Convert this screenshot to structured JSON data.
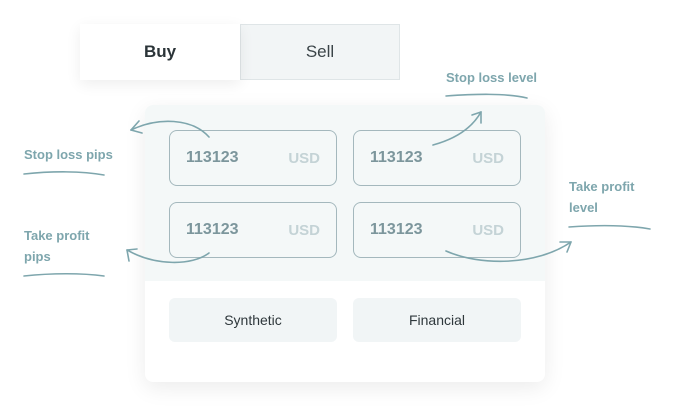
{
  "tabs": {
    "buy": "Buy",
    "sell": "Sell"
  },
  "fields": [
    {
      "value": "113123",
      "currency": "USD"
    },
    {
      "value": "113123",
      "currency": "USD"
    },
    {
      "value": "113123",
      "currency": "USD"
    },
    {
      "value": "113123",
      "currency": "USD"
    }
  ],
  "options": {
    "synthetic": "Synthetic",
    "financial": "Financial"
  },
  "annotations": {
    "stop_loss_level": "Stop loss level",
    "stop_loss_pips": "Stop loss pips",
    "take_profit_pips": "Take profit pips",
    "take_profit_level": "Take profit level"
  },
  "colors": {
    "annotation": "#7ea6ad",
    "field_border": "#a4b8bd",
    "card_top": "#f4f8f8"
  }
}
